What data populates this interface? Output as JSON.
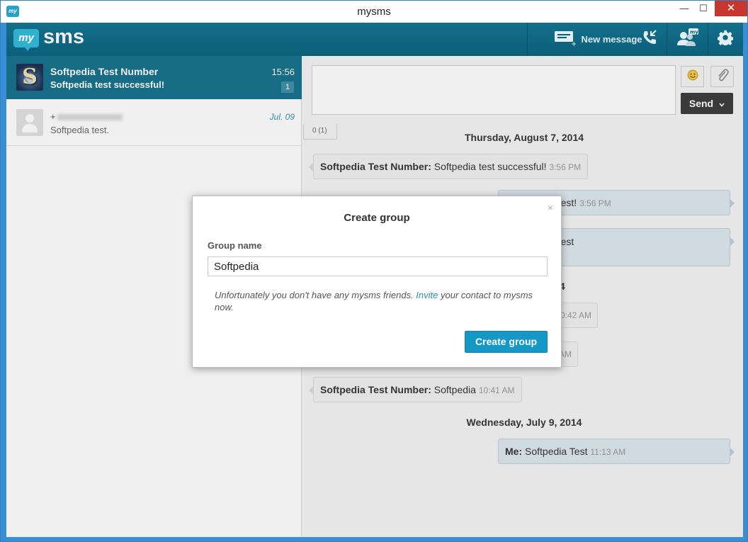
{
  "window": {
    "title": "mysms",
    "app_icon": "my",
    "controls": {
      "minimize": "—",
      "maximize": "☐",
      "close": "✕"
    }
  },
  "toolbar": {
    "logo_my": "my",
    "logo_sms": "sms",
    "new_message_label": "New message",
    "icons": [
      "new-message-icon",
      "call-icon",
      "group-contacts-icon",
      "gear-icon"
    ]
  },
  "conversations": [
    {
      "name": "Softpedia Test Number",
      "preview": "Softpedia test successful!",
      "time": "15:56",
      "unread": "1",
      "active": true
    },
    {
      "name": "+",
      "preview": "Softpedia test.",
      "time": "Jul. 09",
      "active": false
    }
  ],
  "compose": {
    "send_label": "Send",
    "char_count": "0 (1)"
  },
  "messages": {
    "dates": [
      "Thursday, August 7, 2014",
      "014",
      "Wednesday, July 9, 2014"
    ],
    "items": [
      {
        "who": "Softpedia Test Number:",
        "text": "Softpedia test successful!",
        "time": "3:56 PM",
        "dir": "in"
      },
      {
        "who": "",
        "text": "a Softpedia test!",
        "time": "3:56 PM",
        "dir": "out"
      },
      {
        "who": "",
        "text": "a Softpedia test",
        "time": "",
        "dir": "out"
      },
      {
        "who": "",
        "text": "",
        "time": "0:42 AM",
        "dir": "in"
      },
      {
        "who": "",
        "text": "",
        "time": "AM",
        "dir": "in"
      },
      {
        "who": "Softpedia Test Number:",
        "text": "Softpedia",
        "time": "10:41 AM",
        "dir": "in"
      },
      {
        "who": "Me:",
        "text": "Softpedia Test",
        "time": "11:13 AM",
        "dir": "out"
      }
    ]
  },
  "dialog": {
    "title": "Create group",
    "close": "×",
    "field_label": "Group name",
    "group_name_value": "Softpedia",
    "notice_before": "Unfortunately you don't have any mysms friends. ",
    "notice_link": "Invite",
    "notice_after": " your contact to mysms now.",
    "create_button": "Create group"
  },
  "colors": {
    "appbar": "#136f8b",
    "accent_button": "#1598c6",
    "send_button": "#3a3a3a",
    "window_frame": "#3a8ed4",
    "close_button": "#c7372f"
  }
}
